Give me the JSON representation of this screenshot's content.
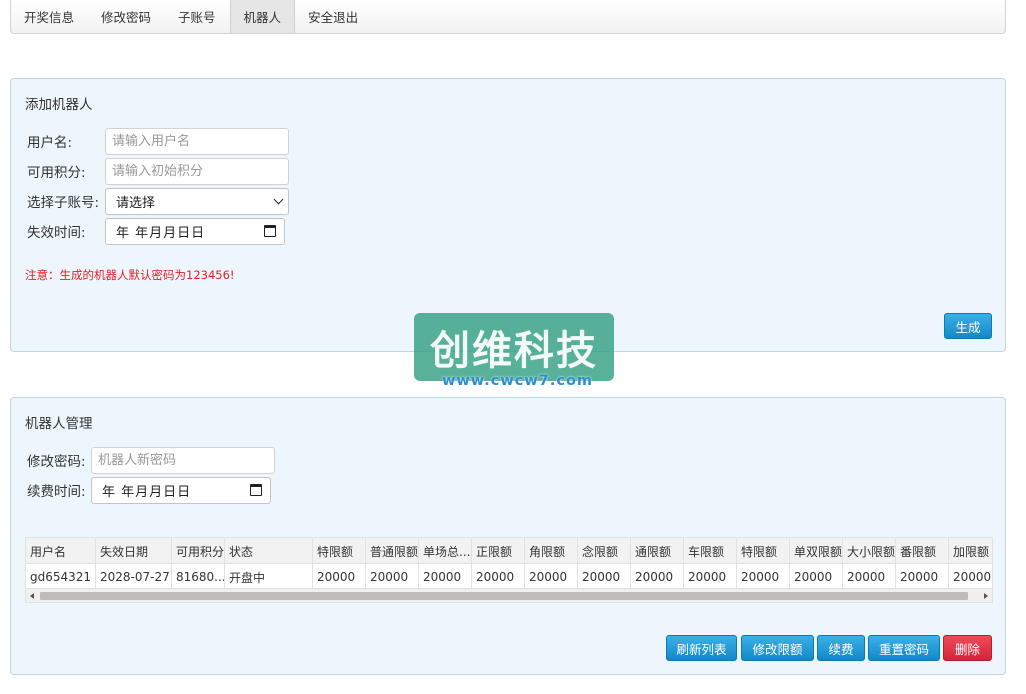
{
  "tabs": [
    {
      "label": "开奖信息",
      "active": false
    },
    {
      "label": "修改密码",
      "active": false
    },
    {
      "label": "子账号",
      "active": false
    },
    {
      "label": "机器人",
      "active": true
    },
    {
      "label": "安全退出",
      "active": false
    }
  ],
  "add_robot": {
    "title": "添加机器人",
    "username_label": "用户名:",
    "username_placeholder": "请输入用户名",
    "points_label": "可用积分:",
    "points_placeholder": "请输入初始积分",
    "subaccount_label": "选择子账号:",
    "subaccount_value": "请选择",
    "expiry_label": "失效时间:",
    "expiry_value": "年 年月月日日",
    "notice": "注意：生成的机器人默认密码为123456!",
    "generate_label": "生成"
  },
  "manage": {
    "title": "机器人管理",
    "password_label": "修改密码:",
    "password_placeholder": "机器人新密码",
    "renew_label": "续费时间:",
    "renew_value": "年 年月月日日",
    "columns": [
      "用户名",
      "失效日期",
      "可用积分",
      "状态",
      "特限额",
      "普通限额",
      "单场总...",
      "正限额",
      "角限额",
      "念限额",
      "通限额",
      "车限额",
      "特限额",
      "单双限额",
      "大小限额",
      "番限额",
      "加限额"
    ],
    "rows": [
      [
        "gd654321",
        "2028-07-27",
        "81680...",
        "开盘中",
        "20000",
        "20000",
        "20000",
        "20000",
        "20000",
        "20000",
        "20000",
        "20000",
        "20000",
        "20000",
        "20000",
        "20000",
        "20000"
      ]
    ],
    "buttons": {
      "refresh": "刷新列表",
      "edit_limit": "修改限额",
      "renew": "续费",
      "reset_password": "重置密码",
      "delete": "删除"
    }
  },
  "watermark": {
    "title": "创维科技",
    "url": "www.cwcw7.com"
  },
  "colors": {
    "accent": "#1a9ad9",
    "danger": "#dc3545",
    "status_open": "#1a8a1a",
    "notice": "#e02020",
    "panel_bg": "#eef6fd"
  }
}
